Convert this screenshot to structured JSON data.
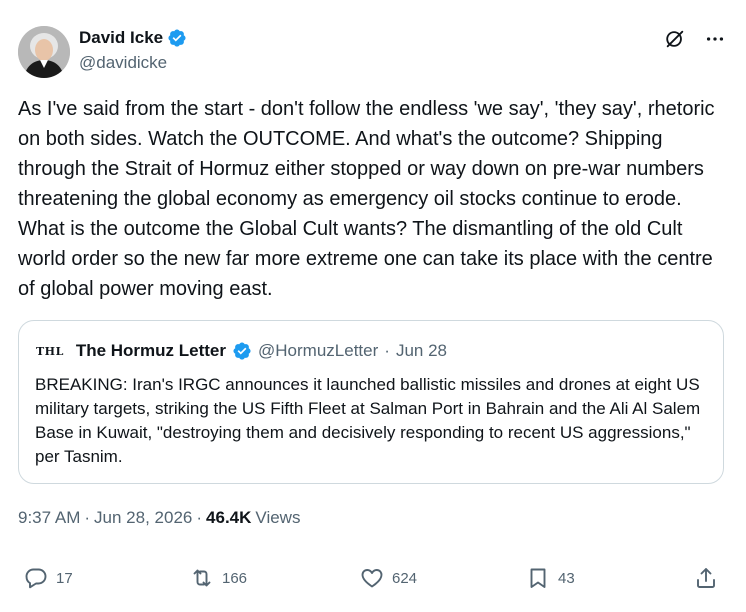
{
  "author": {
    "display_name": "David Icke",
    "handle": "@davidicke",
    "verified_color": "#1d9bf0"
  },
  "tweet": {
    "text": "As I've said from the start - don't follow the endless 'we say', 'they say', rhetoric on both sides. Watch the OUTCOME. And what's the outcome? Shipping through the Strait of Hormuz either stopped or way down on pre-war numbers threatening the global economy as emergency oil stocks continue to erode. What is the outcome the Global Cult wants? The dismantling of the old Cult world order so the new far more extreme one can take its place with the centre of global power moving east."
  },
  "quote": {
    "logo_text": "THL",
    "display_name": "The Hormuz Letter",
    "handle": "@HormuzLetter",
    "separator": "·",
    "date": "Jun 28",
    "text": "BREAKING: Iran's IRGC announces it launched ballistic missiles and drones at eight US military targets, striking the US Fifth Fleet at Salman Port in Bahrain and the Ali Al Salem Base in Kuwait, \"destroying them and decisively responding to recent US aggressions,\" per Tasnim."
  },
  "meta": {
    "time": "9:37 AM",
    "separator": "·",
    "date": "Jun 28, 2026",
    "separator2": "·",
    "views_count": "46.4K",
    "views_label": "Views"
  },
  "actions": {
    "replies": "17",
    "reposts": "166",
    "likes": "624",
    "bookmarks": "43"
  },
  "icons": {
    "grok": "grok-icon",
    "more": "more-icon",
    "reply": "reply-icon",
    "repost": "repost-icon",
    "like": "heart-icon",
    "bookmark": "bookmark-icon",
    "share": "share-icon"
  },
  "colors": {
    "text": "#0f1419",
    "secondary": "#536471",
    "border": "#cfd9de",
    "verified": "#1d9bf0"
  }
}
